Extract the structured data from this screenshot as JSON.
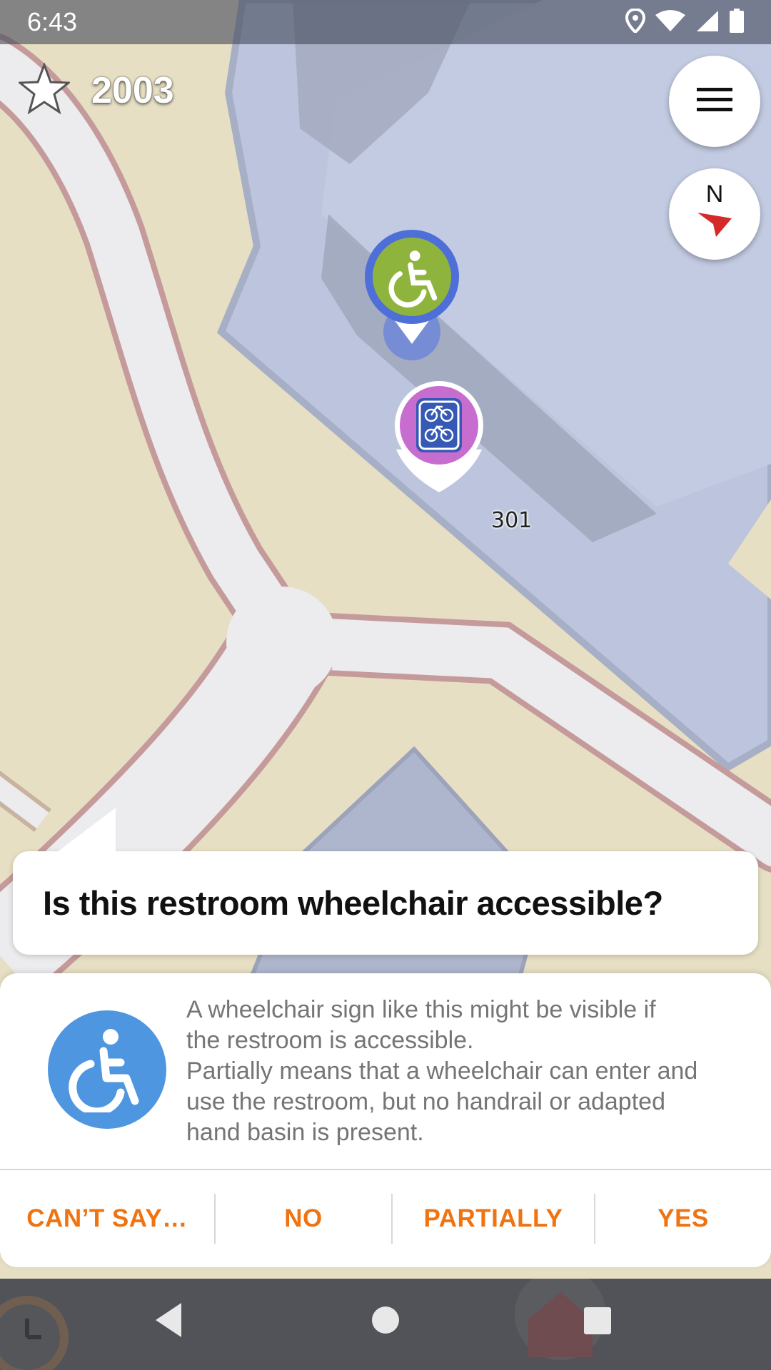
{
  "status_bar": {
    "time": "6:43",
    "icons": [
      "location-icon",
      "wifi-icon",
      "cell-signal-icon",
      "battery-icon"
    ]
  },
  "score": {
    "value": "2003",
    "icon": "star-icon"
  },
  "map": {
    "label": "301",
    "markers": [
      "wheelchair-marker",
      "bicycle-parking-marker"
    ]
  },
  "compass": {
    "north_label": "N"
  },
  "quest": {
    "question": "Is this restroom wheelchair accessible?",
    "description_lines": [
      "A wheelchair sign like this might be visible if",
      "the restroom is accessible.",
      "Partially means that a wheelchair can enter and",
      "use the restroom, but no handrail or adapted",
      "hand basin is present."
    ],
    "icon": "wheelchair-icon"
  },
  "answers": {
    "cant_say": "CAN’T SAY…",
    "no": "NO",
    "partially": "PARTIALLY",
    "yes": "YES"
  },
  "colors": {
    "accent": "#f07311",
    "wheelchair_blue": "#4e96df",
    "marker_green": "#8fb43e",
    "marker_purple": "#c86dd0",
    "building": "#bfc8de",
    "land": "#e6dfc3"
  }
}
